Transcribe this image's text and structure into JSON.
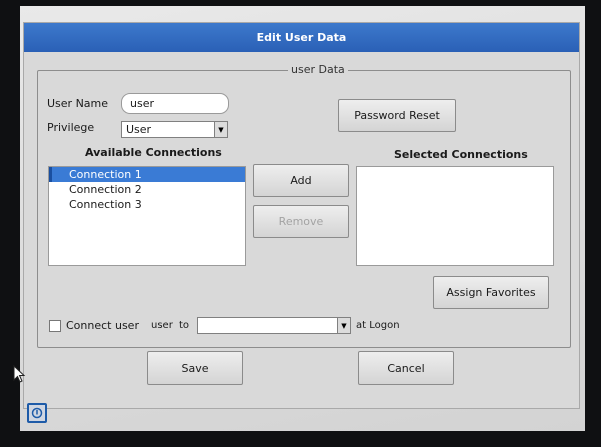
{
  "dialog": {
    "title": "Edit User Data"
  },
  "group": {
    "legend": "user Data"
  },
  "user_name": {
    "label": "User Name",
    "value": "user"
  },
  "privilege": {
    "label": "Privilege",
    "selected": "User"
  },
  "password_reset_label": "Password Reset",
  "available_connections": {
    "heading": "Available Connections",
    "items": [
      "Connection 1",
      "Connection 2",
      "Connection 3"
    ],
    "selected_index": 0
  },
  "selected_connections": {
    "heading": "Selected Connections",
    "items": []
  },
  "add_label": "Add",
  "remove_label": "Remove",
  "assign_favorites_label": "Assign Favorites",
  "connect": {
    "checkbox_label": "Connect user",
    "user_text": "user",
    "to_text": "to",
    "target_value": "",
    "at_logon_text": "at Logon",
    "checked": false
  },
  "save_label": "Save",
  "cancel_label": "Cancel",
  "colors": {
    "titlebar": "#2f6bc0",
    "selection": "#3a7bd5",
    "dialog_bg": "#d9d9d9"
  },
  "icons": {
    "taskbar": "power-icon",
    "cursor": "mouse-pointer-icon",
    "dropdown": "chevron-down-icon"
  }
}
